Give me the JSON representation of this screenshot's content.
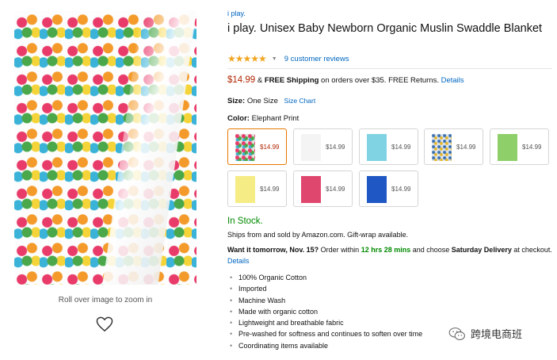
{
  "gallery": {
    "zoom_hint": "Roll over image to zoom in"
  },
  "product": {
    "brand": "i play.",
    "title": "i play. Unisex Baby Newborn Organic Muslin Swaddle Blanket",
    "rating_stars": "★★★★★",
    "rating_value": 5,
    "reviews_link": "9 customer reviews",
    "price": "$14.99",
    "shipping_prefix": "& ",
    "shipping_bold": "FREE Shipping",
    "shipping_rest": " on orders over $35. FREE Returns. ",
    "shipping_details_link": "Details",
    "size_label": "Size:",
    "size_value": "One Size",
    "size_chart_link": "Size Chart",
    "color_label": "Color:",
    "color_value": "Elephant Print",
    "swatches": [
      {
        "price": "$14.99",
        "color": "#e9e4de",
        "pattern": "elephant",
        "selected": true
      },
      {
        "price": "$14.99",
        "color": "#f4f4f4",
        "pattern": "plain",
        "selected": false
      },
      {
        "price": "$14.99",
        "color": "#7fd3e3",
        "pattern": "plain",
        "selected": false
      },
      {
        "price": "$14.99",
        "color": "#dde6f0",
        "pattern": "print",
        "selected": false
      },
      {
        "price": "$14.99",
        "color": "#8fcf6a",
        "pattern": "plain",
        "selected": false
      },
      {
        "price": "$14.99",
        "color": "#f6ec86",
        "pattern": "plain",
        "selected": false
      },
      {
        "price": "$14.99",
        "color": "#e0476f",
        "pattern": "plain",
        "selected": false
      },
      {
        "price": "$14.99",
        "color": "#1f57c4",
        "pattern": "plain",
        "selected": false
      }
    ],
    "stock": "In Stock.",
    "ships": "Ships from and sold by Amazon.com. Gift-wrap available.",
    "delivery": {
      "bold_lead": "Want it tomorrow, Nov. 15?",
      "order_within": " Order within ",
      "countdown": "12 hrs 28 mins",
      "and_choose": " and choose ",
      "delivery_option": "Saturday Delivery",
      "at_checkout": " at checkout. ",
      "details_link": "Details"
    },
    "bullets": [
      "100% Organic Cotton",
      "Imported",
      "Machine Wash",
      "Made with organic cotton",
      "Lightweight and breathable fabric",
      "Pre-washed for softness and continues to soften over time",
      "Coordinating items available"
    ]
  },
  "watermark": {
    "text": "跨境电商班",
    "icon": "wechat-icon"
  },
  "colors": {
    "link": "#0066c0",
    "price": "#b12704",
    "stock": "#008a00",
    "star": "#f0a521",
    "selected_border": "#e77600"
  }
}
